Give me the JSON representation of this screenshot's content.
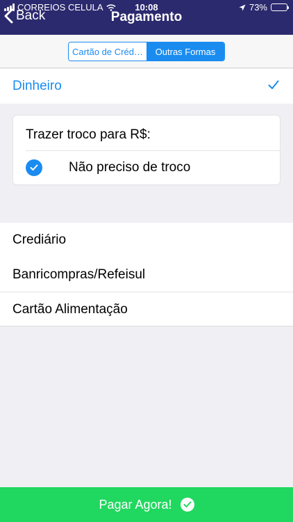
{
  "status_bar": {
    "carrier": "CORREIOS CELULA",
    "time": "10:08",
    "battery": "73%",
    "battery_level": 0.73
  },
  "nav": {
    "back_label": "Back",
    "title": "Pagamento"
  },
  "segments": [
    {
      "label": "Cartão de Créd…",
      "selected": false
    },
    {
      "label": "Outras Formas",
      "selected": true
    }
  ],
  "options": {
    "dinheiro": {
      "label": "Dinheiro",
      "selected": true
    },
    "troco": {
      "prompt": "Trazer troco para R$:",
      "no_change_label": "Não preciso de troco",
      "no_change_checked": true
    },
    "others": [
      "Crediário",
      "Banricompras/Refeisul",
      "Cartão Alimentação"
    ]
  },
  "footer": {
    "pay_label": "Pagar Agora!"
  },
  "colors": {
    "nav_bg": "#2c2a6e",
    "accent": "#1a8cf0",
    "pay_bg": "#20d85f"
  }
}
